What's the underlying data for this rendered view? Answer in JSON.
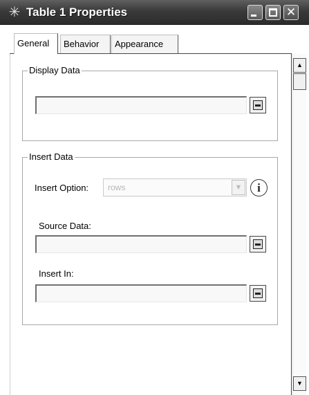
{
  "window": {
    "title": "Table 1 Properties",
    "title_icon": "wand-star-icon",
    "controls": {
      "minimize_icon": "minimize-icon",
      "maximize_icon": "maximize-icon",
      "close_glyph": "✕"
    }
  },
  "tabs": [
    {
      "label": "General",
      "active": true
    },
    {
      "label": "Behavior",
      "active": false
    },
    {
      "label": "Appearance",
      "active": false
    }
  ],
  "display_data": {
    "group_label": "Display Data",
    "value": ""
  },
  "insert_data": {
    "group_label": "Insert Data",
    "insert_option_label": "Insert Option:",
    "insert_option_value": "rows",
    "source_data_label": "Source Data:",
    "source_data_value": "",
    "insert_in_label": "Insert In:",
    "insert_in_value": ""
  },
  "icons": {
    "info": "i",
    "scroll_up": "▲",
    "scroll_down": "▼",
    "dropdown": "▼"
  }
}
